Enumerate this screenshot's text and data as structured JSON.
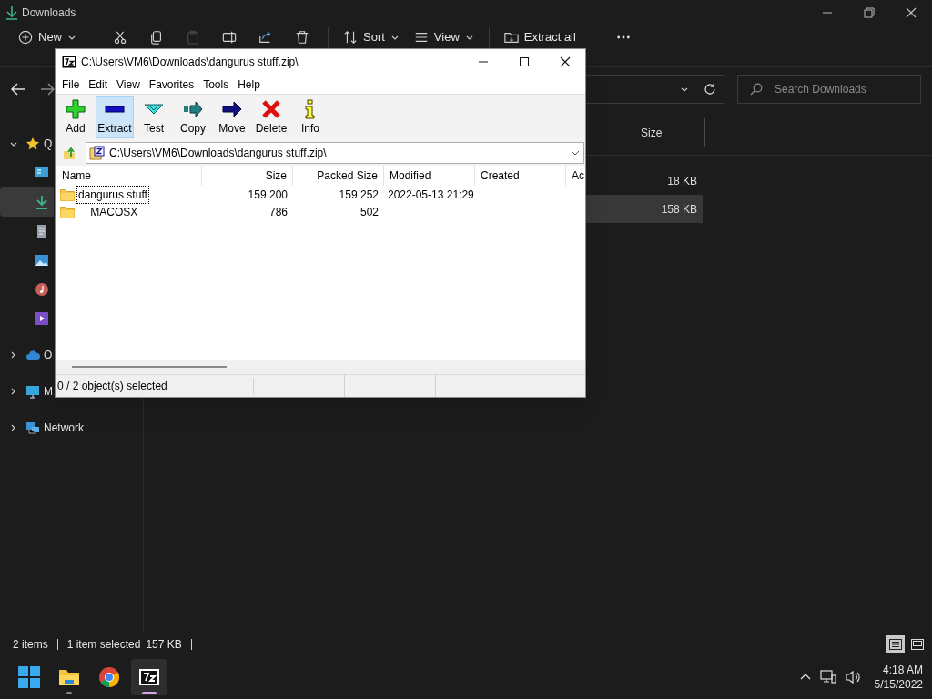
{
  "explorer": {
    "title": "Downloads",
    "command_bar": [
      {
        "kind": "new",
        "label": "New"
      },
      {
        "kind": "cut"
      },
      {
        "kind": "copy"
      },
      {
        "kind": "paste",
        "disabled": true
      },
      {
        "kind": "rename"
      },
      {
        "kind": "share"
      },
      {
        "kind": "delete"
      },
      {
        "kind": "sort",
        "label": "Sort"
      },
      {
        "kind": "view",
        "label": "View"
      },
      {
        "kind": "extract",
        "label": "Extract all"
      },
      {
        "kind": "more"
      }
    ],
    "search": {
      "placeholder": "Search Downloads"
    },
    "sidebar": {
      "items": [
        {
          "kind": "quick",
          "label": "Q",
          "expanded": true,
          "children": [
            {
              "kind": "desktop",
              "selected": false
            },
            {
              "kind": "downloads",
              "selected": true
            },
            {
              "kind": "documents",
              "selected": false
            },
            {
              "kind": "pictures",
              "selected": false
            },
            {
              "kind": "music",
              "selected": false
            },
            {
              "kind": "videos",
              "selected": false
            }
          ]
        },
        {
          "kind": "onedrive",
          "label": "O",
          "expanded": false
        },
        {
          "kind": "pc",
          "label": "M",
          "expanded": false
        },
        {
          "kind": "network",
          "label": "Network",
          "expanded": false
        }
      ]
    },
    "columns": [
      {
        "label": "Size"
      }
    ],
    "rows": [
      {
        "size": "18 KB",
        "selected": false
      },
      {
        "size": "158 KB",
        "selected": true
      }
    ],
    "status_bar": {
      "count": "2 items",
      "selection": "1 item selected",
      "size": "157 KB"
    }
  },
  "zip_window": {
    "title": "C:\\Users\\VM6\\Downloads\\dangurus stuff.zip\\",
    "menu": [
      "File",
      "Edit",
      "View",
      "Favorites",
      "Tools",
      "Help"
    ],
    "toolbar": [
      {
        "kind": "add",
        "label": "Add",
        "hovered": false
      },
      {
        "kind": "extract",
        "label": "Extract",
        "hovered": true
      },
      {
        "kind": "test",
        "label": "Test",
        "hovered": false
      },
      {
        "kind": "copy",
        "label": "Copy",
        "hovered": false
      },
      {
        "kind": "move",
        "label": "Move",
        "hovered": false
      },
      {
        "kind": "delete",
        "label": "Delete",
        "hovered": false
      },
      {
        "kind": "info",
        "label": "Info",
        "hovered": false
      }
    ],
    "path": "C:\\Users\\VM6\\Downloads\\dangurus stuff.zip\\",
    "columns": [
      {
        "label": "Name"
      },
      {
        "label": "Size"
      },
      {
        "label": "Packed Size"
      },
      {
        "label": "Modified"
      },
      {
        "label": "Created"
      },
      {
        "label": "Ac"
      }
    ],
    "rows": [
      {
        "cells": [
          "dangurus stuff",
          "159 200",
          "159 252",
          "2022-05-13 21:29"
        ],
        "focused": true
      },
      {
        "cells": [
          "__MACOSX",
          "786",
          "502"
        ],
        "focused": false
      }
    ],
    "status_bar": "0 / 2 object(s) selected"
  },
  "taskbar": {
    "apps": [
      {
        "kind": "start",
        "running": false,
        "active": false
      },
      {
        "kind": "explorer",
        "running": true,
        "active": false
      },
      {
        "kind": "chrome",
        "running": false,
        "active": false
      },
      {
        "kind": "sevenzip",
        "running": true,
        "active": true
      }
    ],
    "time": "4:18 AM",
    "date": "5/15/2022"
  }
}
